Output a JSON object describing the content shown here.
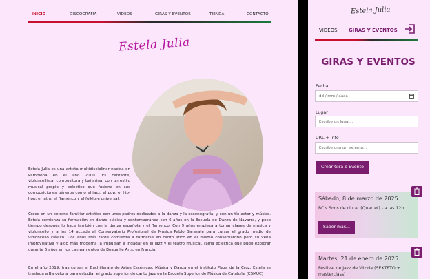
{
  "site": {
    "nav": [
      "INICIO",
      "DISCOGRAFÍA",
      "VIDEOS",
      "GIRAS Y EVENTOS",
      "TIENDA",
      "CONTACTO"
    ],
    "logo": "Estela Julia",
    "intro": "Estela Julia es una artista multidisciplinar nacida en Pamplona en el año 2000. Es cantante, violoncellista, compositora y bailarina, con un estilo musical propio y ecléctico que fusiona en sus composiciones géneros como el jazz, el pop, el hip-hop, el latin, el flamenco y el folklore universal.",
    "para2": "Crece en un entorno familiar artístico con unos padres dedicados a la danza y la escenografía, y con un tío actor y músico. Estela comienza su formación en danza clásica y contemporánea con 6 años en la Escuela de Danza de Navarra, y poco tiempo después lo hace también con la danza española y el flamenco. Con 9 años empieza a tomar clases de música y violoncello y a los 14 accede al Conservatorio Profesional de Música Pablo Sarasate para cursar el grado medio de violoncello clásico. Dos años más tarde comienza a formarse en canto lírico en el mismo conservatorio pero su vena improvisativa y algo más moderna la impulsan a indagar en el jazz y el teatro musical, rama ecléctica que pudo explorar durante 6 años en los campamentos de Beauville Arts, en Francia.",
    "para3": "En el año 2019, tras cursar el Bachillerato de Artes Escénicas, Música y Danza en el instituto Plaza de la Cruz, Estela se traslada a Barcelona para estudiar el grado superior de canto jazz en la Escuela Superior de Música de Cataluña (ESMUC)"
  },
  "app": {
    "logo": "Estela Julia",
    "tabs": [
      "VIDEOS",
      "GIRAS Y EVENTOS"
    ],
    "heading": "GIRAS Y EVENTOS",
    "form": {
      "fecha_label": "Fecha",
      "fecha_placeholder": "dd / mm / aaaa",
      "lugar_label": "Lugar",
      "lugar_placeholder": "Escribe un lugar...",
      "url_label": "URL + Info",
      "url_placeholder": "Escribe una url externa...",
      "submit": "Crear Gira o Evento"
    },
    "events": [
      {
        "date": "Sábado, 8 de marzo de 2025",
        "desc": "BCN Sons de ciutat (Quartet) - a las 12h",
        "button": "Saber más..."
      },
      {
        "date": "Martes, 21 de enero de 2025",
        "desc": "Festival de Jazz de Vitoria (SEXTETO + masterclass)"
      }
    ]
  },
  "colors": {
    "accent": "#7b1d6f",
    "brand_pink": "#b5179e",
    "page_bg": "#fbe6fb",
    "nav_active": "#c8102e"
  },
  "icons": [
    "calendar-icon",
    "logout-icon",
    "trash-icon"
  ]
}
